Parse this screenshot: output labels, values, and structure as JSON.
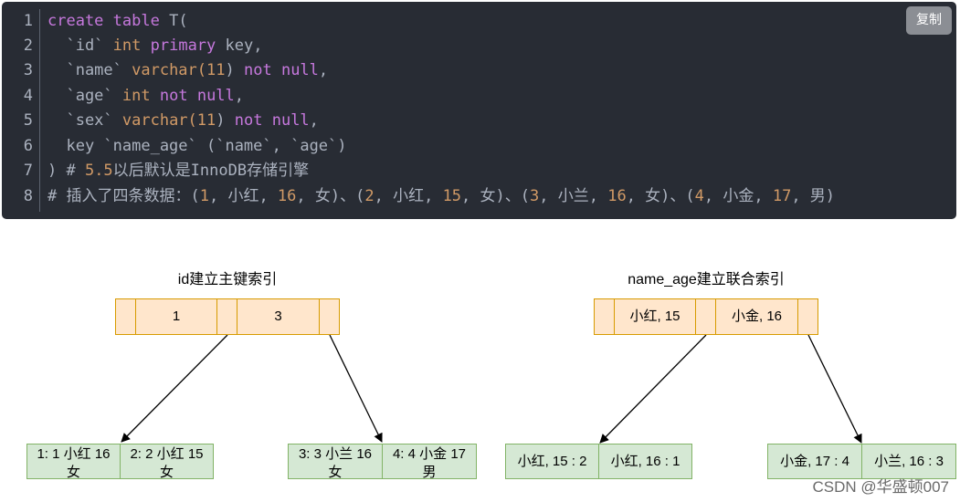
{
  "code_block": {
    "copy_button_label": "复制",
    "line_numbers": [
      "1",
      "2",
      "3",
      "4",
      "5",
      "6",
      "7",
      "8"
    ]
  },
  "diagram_left": {
    "title": "id建立主键索引",
    "root_keys": [
      "1",
      "3"
    ],
    "leaf_1": {
      "line1": "1: 1 小红 16",
      "line2": "女"
    },
    "leaf_2": {
      "line1": "2: 2 小红 15",
      "line2": "女"
    },
    "leaf_3": {
      "line1": "3: 3 小兰 16",
      "line2": "女"
    },
    "leaf_4": {
      "line1": "4: 4 小金 17",
      "line2": "男"
    }
  },
  "diagram_right": {
    "title": "name_age建立联合索引",
    "root_keys": [
      "小红, 15",
      "小金, 16"
    ],
    "leaf_1": "小红, 15 : 2",
    "leaf_2": "小红, 16 : 1",
    "leaf_3": "小金, 17 : 4",
    "leaf_4": "小兰, 16 : 3"
  },
  "watermark": "CSDN @华盛顿007"
}
